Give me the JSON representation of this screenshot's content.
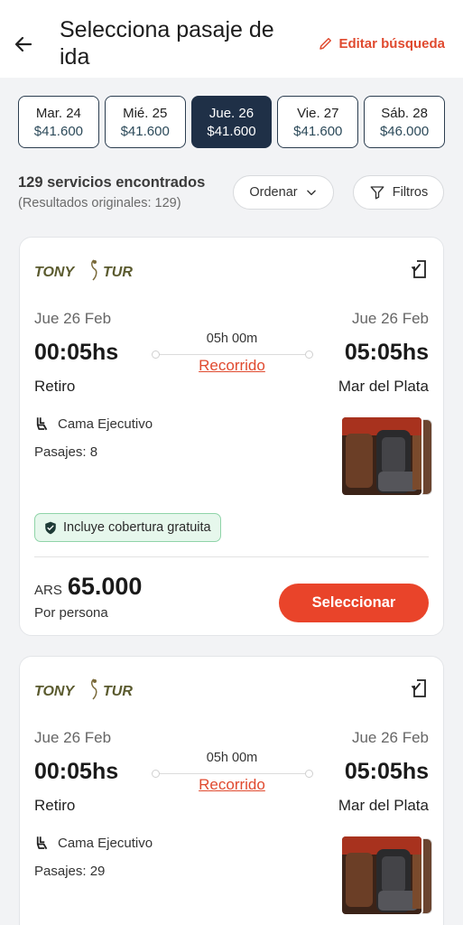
{
  "header": {
    "title": "Selecciona pasaje de ida",
    "edit_label": "Editar búsqueda"
  },
  "dates": [
    {
      "day": "Mar. 24",
      "price": "$41.600",
      "active": false
    },
    {
      "day": "Mié. 25",
      "price": "$41.600",
      "active": false
    },
    {
      "day": "Jue. 26",
      "price": "$41.600",
      "active": true
    },
    {
      "day": "Vie. 27",
      "price": "$41.600",
      "active": false
    },
    {
      "day": "Sáb. 28",
      "price": "$46.000",
      "active": false
    }
  ],
  "results": {
    "count": "129 servicios encontrados",
    "original": "(Resultados originales: 129)"
  },
  "controls": {
    "order_label": "Ordenar",
    "filter_label": "Filtros"
  },
  "trips": [
    {
      "operator": "TONY TUR",
      "dep_date": "Jue 26 Feb",
      "arr_date": "Jue 26 Feb",
      "dep_time": "00:05hs",
      "arr_time": "05:05hs",
      "duration": "05h 00m",
      "route_label": "Recorrido",
      "origin": "Retiro",
      "destination": "Mar del Plata",
      "seat_type": "Cama Ejecutivo",
      "seats": "Pasajes: 8",
      "badge": "Incluye cobertura gratuita",
      "currency": "ARS",
      "price": "65.000",
      "per_person": "Por persona",
      "select_label": "Seleccionar"
    },
    {
      "operator": "TONY TUR",
      "dep_date": "Jue 26 Feb",
      "arr_date": "Jue 26 Feb",
      "dep_time": "00:05hs",
      "arr_time": "05:05hs",
      "duration": "05h 00m",
      "route_label": "Recorrido",
      "origin": "Retiro",
      "destination": "Mar del Plata",
      "seat_type": "Cama Ejecutivo",
      "seats": "Pasajes: 29"
    }
  ],
  "colors": {
    "accent": "#e9442a",
    "active_chip": "#1f3047",
    "badge_bg": "#e6f7ec"
  },
  "icons": [
    "arrow-left-icon",
    "pencil-icon",
    "chevron-down-icon",
    "filter-icon",
    "ticket-mobile-icon",
    "seat-icon",
    "shield-check-icon"
  ]
}
